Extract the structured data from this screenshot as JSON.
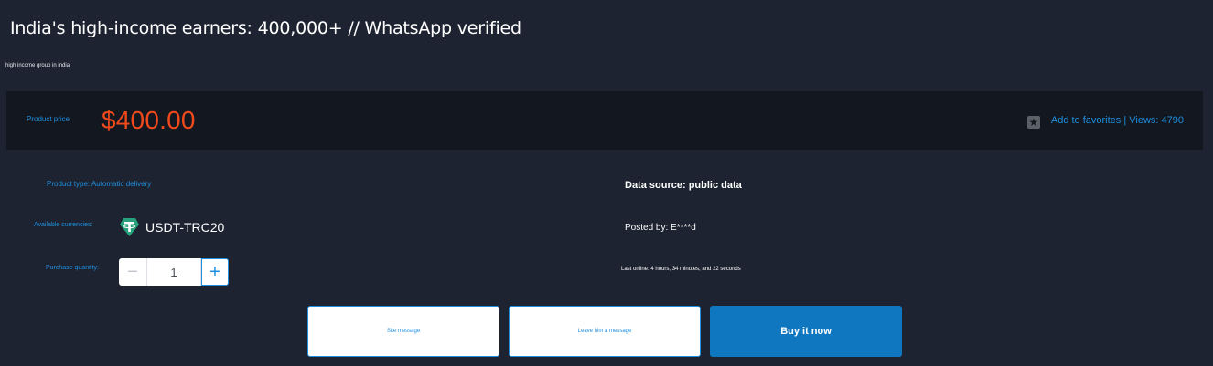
{
  "header": {
    "title": "India's high-income earners: 400,000+ // WhatsApp verified",
    "subtitle": "high income group in india"
  },
  "price_bar": {
    "label": "Product price",
    "price": "$400.00",
    "favorites_text": "Add to favorites | Views: 4790",
    "star_icon": "star-icon"
  },
  "details": {
    "product_type": "Product type: Automatic delivery",
    "currencies_label": "Available currencies:",
    "currency_name": "USDT-TRC20",
    "currency_icon": "tether-icon",
    "quantity_label": "Purchase quantity:",
    "quantity_value": "1",
    "minus_symbol": "−",
    "plus_symbol": "+"
  },
  "info": {
    "data_source": "Data source: public data",
    "posted_by": "Posted by: E****d",
    "last_online": "Last online: 4 hours, 34 minutes, and 22 seconds"
  },
  "actions": {
    "site_message": "Site message",
    "leave_message": "Leave him a message",
    "buy_now": "Buy it now"
  },
  "colors": {
    "background": "#1d2330",
    "price_bar_bg": "#121720",
    "accent_blue": "#1e8fe0",
    "price_red": "#f04a1c",
    "buy_button": "#0e77c0",
    "tether_green": "#26a17b"
  }
}
